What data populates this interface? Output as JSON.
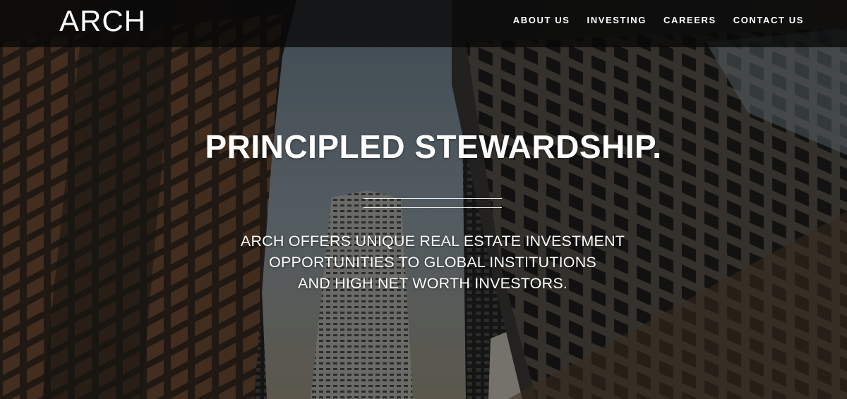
{
  "header": {
    "logo_text": "ARCH",
    "nav": [
      {
        "label": "ABOUT US"
      },
      {
        "label": "INVESTING"
      },
      {
        "label": "CAREERS"
      },
      {
        "label": "CONTACT US"
      }
    ]
  },
  "hero": {
    "title": "PRINCIPLED STEWARDSHIP.",
    "subtitle_lines": [
      "ARCH OFFERS UNIQUE REAL ESTATE INVESTMENT",
      "OPPORTUNITIES TO GLOBAL INSTITUTIONS",
      "AND HIGH NET WORTH INVESTORS."
    ]
  },
  "colors": {
    "header_bg": "#080808",
    "text": "#ffffff",
    "sky": "#6b7a86"
  }
}
